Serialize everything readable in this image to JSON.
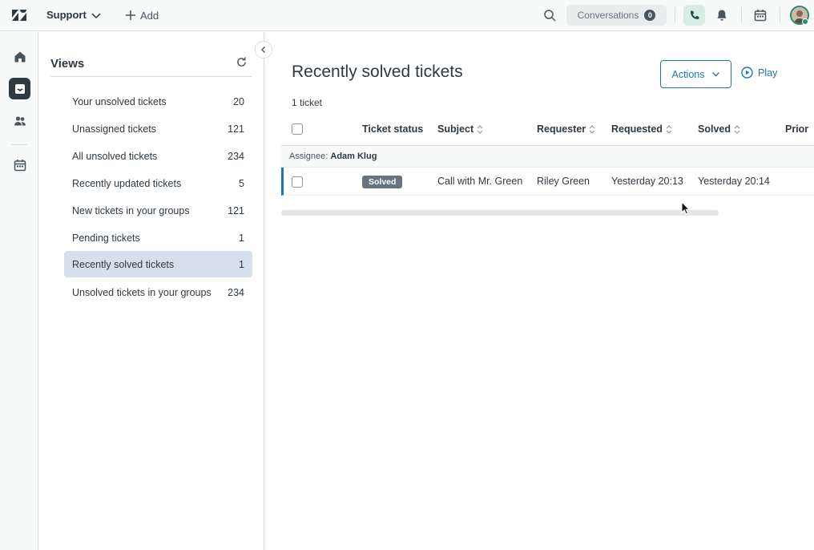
{
  "topbar": {
    "product": "Support",
    "add_label": "Add",
    "conversations_label": "Conversations",
    "conversations_count": "0"
  },
  "rail": {
    "items": [
      "home-icon",
      "views-icon",
      "customers-icon",
      "calendar-icon"
    ],
    "active": "views-icon"
  },
  "views": {
    "title": "Views",
    "items": [
      {
        "label": "Your unsolved tickets",
        "count": "20"
      },
      {
        "label": "Unassigned tickets",
        "count": "121"
      },
      {
        "label": "All unsolved tickets",
        "count": "234"
      },
      {
        "label": "Recently updated tickets",
        "count": "5"
      },
      {
        "label": "New tickets in your groups",
        "count": "121"
      },
      {
        "label": "Pending tickets",
        "count": "1"
      },
      {
        "label": "Recently solved tickets",
        "count": "1"
      },
      {
        "label": "Unsolved tickets in your groups",
        "count": "234"
      }
    ],
    "selected": "Recently solved tickets"
  },
  "main": {
    "title": "Recently solved tickets",
    "actions_label": "Actions",
    "play_label": "Play",
    "count_text": "1 ticket",
    "columns": [
      "Ticket status",
      "Subject",
      "Requester",
      "Requested",
      "Solved",
      "Prior"
    ],
    "group": {
      "prefix": "Assignee:",
      "name": "Adam Klug"
    },
    "rows": [
      {
        "status": "Solved",
        "subject": "Call with Mr. Green",
        "requester": "Riley Green",
        "requested": "Yesterday 20:13",
        "solved": "Yesterday 20:14"
      }
    ]
  },
  "colors": {
    "accent": "#1f73b7",
    "active_view_bg": "#d5e0ec",
    "status_solved": "#68737d",
    "online": "#228f67"
  }
}
